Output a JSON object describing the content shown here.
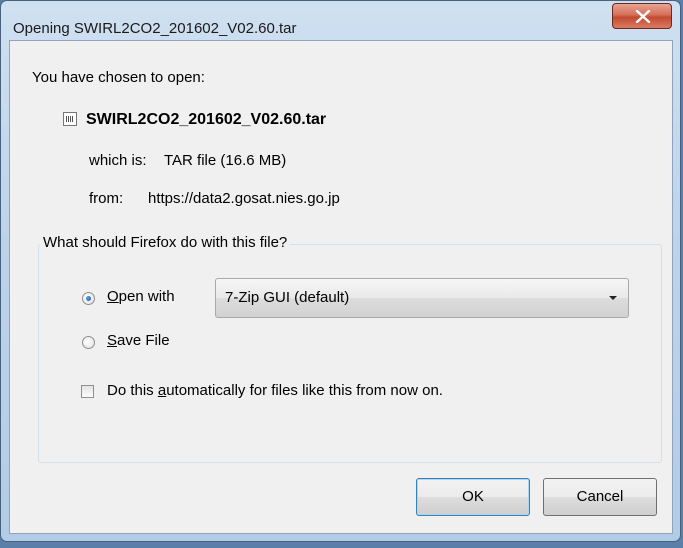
{
  "window": {
    "title": "Opening SWIRL2CO2_201602_V02.60.tar",
    "close_icon": "close-x-icon"
  },
  "dialog": {
    "intro": "You have chosen to open:",
    "file_icon": "archive-file-icon",
    "filename": "SWIRL2CO2_201602_V02.60.tar",
    "which_is_label": "which is:",
    "which_is_value": "TAR file (16.6 MB)",
    "from_label": "from:",
    "from_value": "https://data2.gosat.nies.go.jp"
  },
  "action_group": {
    "legend": "What should Firefox do with this file?",
    "open_with": {
      "mnemonic": "O",
      "rest": "pen with",
      "selected": true,
      "app_selected": "7-Zip GUI (default)"
    },
    "save_file": {
      "mnemonic": "S",
      "rest": "ave File",
      "selected": false
    },
    "auto": {
      "before": "Do this ",
      "mnemonic": "a",
      "after": "utomatically for files like this from now on.",
      "checked": false
    }
  },
  "buttons": {
    "ok_label": "OK",
    "cancel_label": "Cancel"
  }
}
